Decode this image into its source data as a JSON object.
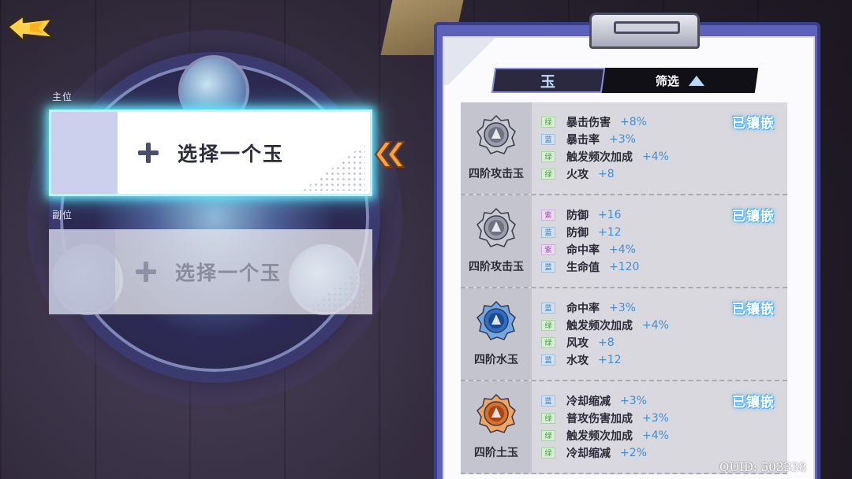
{
  "colors": {
    "accent_cyan": "#5fe6ff",
    "stat_value_blue": "#3f8ed8",
    "clipboard_purple": "#5d62b8",
    "equipped_glow": "#4fb8ff",
    "back_arrow_yellow": "#ffd24a"
  },
  "back_button": {
    "icon": "back-arrow-icon"
  },
  "slots": {
    "main": {
      "label": "主位",
      "text": "选择一个玉",
      "icon": "plus-icon"
    },
    "sub": {
      "label": "副位",
      "text": "选择一个玉",
      "icon": "plus-icon"
    }
  },
  "pointer": {
    "icon": "double-chevron-left-icon"
  },
  "tabs": {
    "jade": "玉",
    "filter": "筛选",
    "filter_icon": "triangle-up-icon"
  },
  "jades": [
    {
      "name": "四阶攻击玉",
      "icon": "silver-attack-jade-icon",
      "status": "已镶嵌",
      "stats": [
        {
          "rarity": "绿",
          "rarity_class": "r-green",
          "name": "暴击伤害",
          "value": "+8%"
        },
        {
          "rarity": "蓝",
          "rarity_class": "r-blue",
          "name": "暴击率",
          "value": "+3%"
        },
        {
          "rarity": "绿",
          "rarity_class": "r-green",
          "name": "触发频次加成",
          "value": "+4%"
        },
        {
          "rarity": "绿",
          "rarity_class": "r-green",
          "name": "火攻",
          "value": "+8"
        }
      ]
    },
    {
      "name": "四阶攻击玉",
      "icon": "silver-attack-jade-icon",
      "status": "已镶嵌",
      "stats": [
        {
          "rarity": "紫",
          "rarity_class": "r-purple",
          "name": "防御",
          "value": "+16"
        },
        {
          "rarity": "蓝",
          "rarity_class": "r-blue",
          "name": "防御",
          "value": "+12"
        },
        {
          "rarity": "紫",
          "rarity_class": "r-purple",
          "name": "命中率",
          "value": "+4%"
        },
        {
          "rarity": "蓝",
          "rarity_class": "r-blue",
          "name": "生命值",
          "value": "+120"
        }
      ]
    },
    {
      "name": "四阶水玉",
      "icon": "blue-water-jade-icon",
      "status": "已镶嵌",
      "stats": [
        {
          "rarity": "蓝",
          "rarity_class": "r-blue",
          "name": "命中率",
          "value": "+3%"
        },
        {
          "rarity": "绿",
          "rarity_class": "r-green",
          "name": "触发频次加成",
          "value": "+4%"
        },
        {
          "rarity": "绿",
          "rarity_class": "r-green",
          "name": "风攻",
          "value": "+8"
        },
        {
          "rarity": "蓝",
          "rarity_class": "r-blue",
          "name": "水攻",
          "value": "+12"
        }
      ]
    },
    {
      "name": "四阶土玉",
      "icon": "orange-earth-jade-icon",
      "status": "已镶嵌",
      "stats": [
        {
          "rarity": "蓝",
          "rarity_class": "r-blue",
          "name": "冷却缩减",
          "value": "+3%"
        },
        {
          "rarity": "绿",
          "rarity_class": "r-green",
          "name": "普攻伤害加成",
          "value": "+3%"
        },
        {
          "rarity": "绿",
          "rarity_class": "r-green",
          "name": "触发频次加成",
          "value": "+4%"
        },
        {
          "rarity": "绿",
          "rarity_class": "r-green",
          "name": "冷却缩减",
          "value": "+2%"
        }
      ]
    }
  ],
  "footer": {
    "quid": "QUID: 503338"
  }
}
